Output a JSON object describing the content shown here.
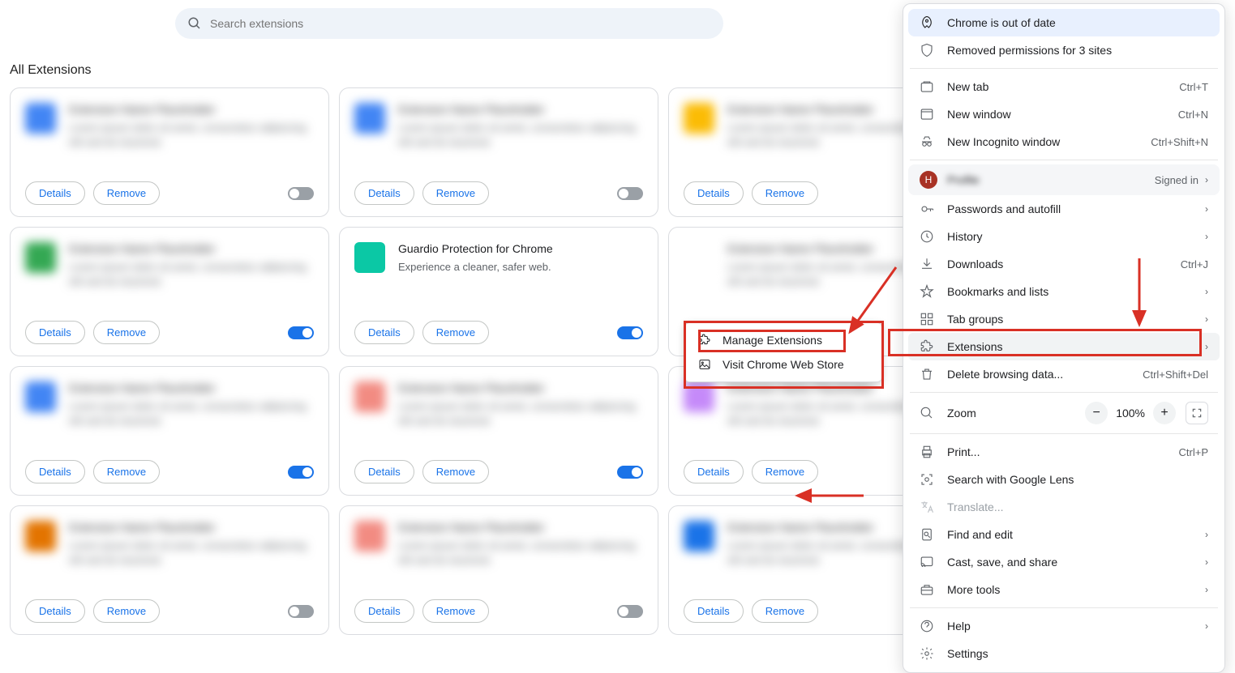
{
  "search": {
    "placeholder": "Search extensions"
  },
  "section_title": "All Extensions",
  "buttons": {
    "details": "Details",
    "remove": "Remove"
  },
  "cards": [
    {
      "icon_bg": "#4285f4",
      "toggle": "off",
      "blurred": true
    },
    {
      "icon_bg": "#4285f4",
      "toggle": "off",
      "blurred": true
    },
    {
      "icon_bg": "#fbbc05",
      "toggle": null,
      "blurred": true
    },
    {
      "icon_bg": "#34a853",
      "toggle": "on",
      "blurred": true
    },
    {
      "icon_bg": "#0bc8a5",
      "toggle": "on",
      "blurred": false,
      "title": "Guardio Protection for Chrome",
      "desc": "Experience a cleaner, safer web."
    },
    {
      "icon_bg": "#ffffff",
      "toggle": null,
      "blurred": true
    },
    {
      "icon_bg": "#4285f4",
      "toggle": "on",
      "blurred": true
    },
    {
      "icon_bg": "#f28b82",
      "toggle": "on",
      "blurred": true
    },
    {
      "icon_bg": "#c58af9",
      "toggle": null,
      "blurred": true
    },
    {
      "icon_bg": "#e37400",
      "toggle": "off",
      "blurred": true
    },
    {
      "icon_bg": "#f28b82",
      "toggle": "off",
      "blurred": true
    },
    {
      "icon_bg": "#1a73e8",
      "toggle": null,
      "blurred": true
    }
  ],
  "context_menu": {
    "manage": "Manage Extensions",
    "visit": "Visit Chrome Web Store"
  },
  "chrome_menu": {
    "update": "Chrome is out of date",
    "removed_perms": "Removed permissions for 3 sites",
    "new_tab": {
      "label": "New tab",
      "shortcut": "Ctrl+T"
    },
    "new_window": {
      "label": "New window",
      "shortcut": "Ctrl+N"
    },
    "incognito": {
      "label": "New Incognito window",
      "shortcut": "Ctrl+Shift+N"
    },
    "profile": {
      "initial": "H",
      "name": "Profile",
      "status": "Signed in"
    },
    "passwords": "Passwords and autofill",
    "history": "History",
    "downloads": {
      "label": "Downloads",
      "shortcut": "Ctrl+J"
    },
    "bookmarks": "Bookmarks and lists",
    "tab_groups": "Tab groups",
    "extensions": "Extensions",
    "delete_data": {
      "label": "Delete browsing data...",
      "shortcut": "Ctrl+Shift+Del"
    },
    "zoom": {
      "label": "Zoom",
      "value": "100%"
    },
    "print": {
      "label": "Print...",
      "shortcut": "Ctrl+P"
    },
    "lens": "Search with Google Lens",
    "translate": "Translate...",
    "find": "Find and edit",
    "cast": "Cast, save, and share",
    "more_tools": "More tools",
    "help": "Help",
    "settings": "Settings"
  }
}
